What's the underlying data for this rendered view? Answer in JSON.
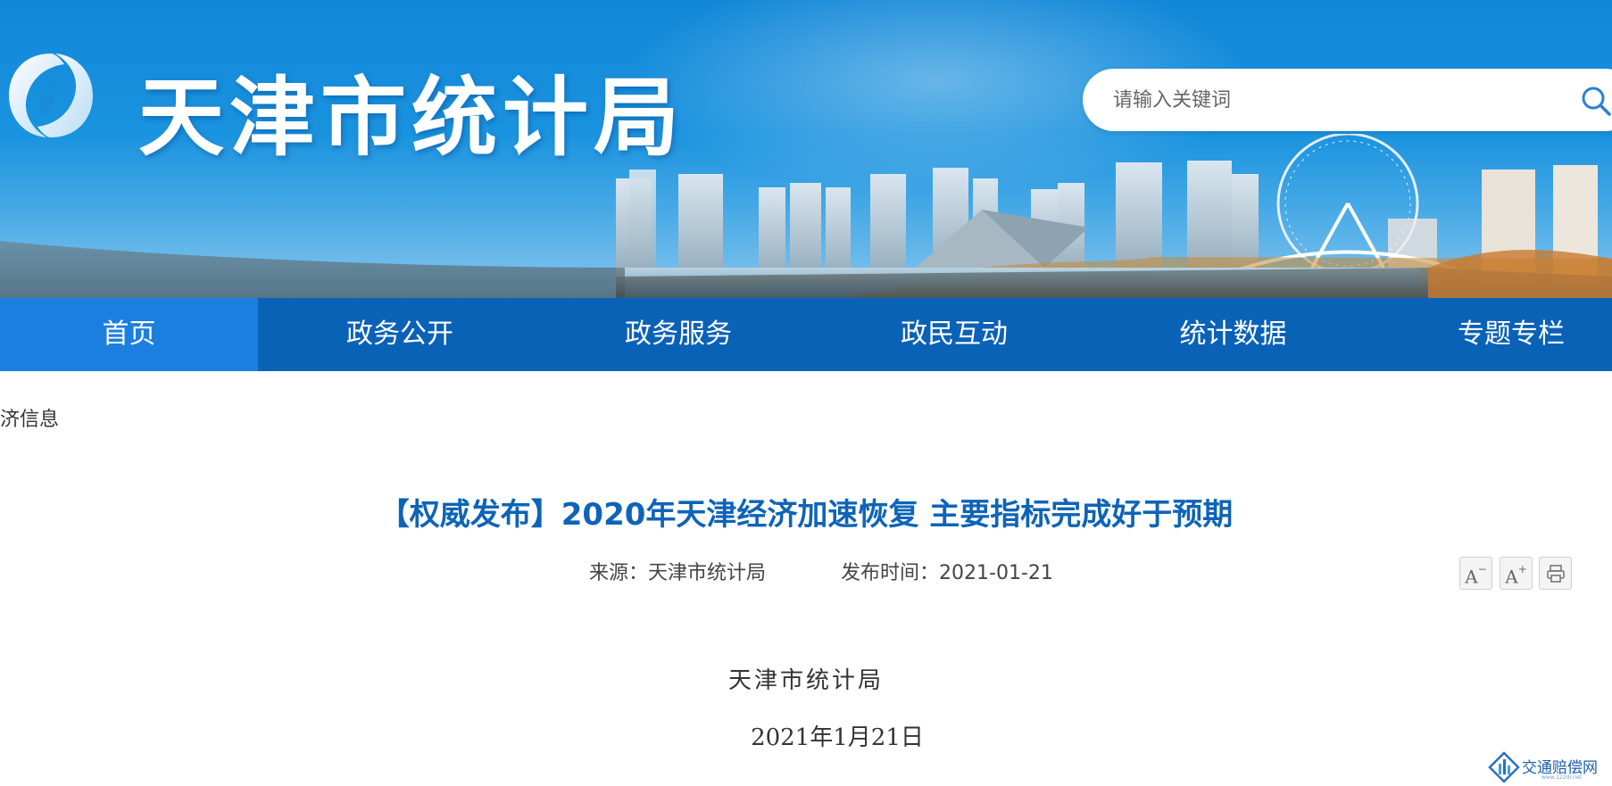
{
  "header": {
    "site_title": "天津市统计局",
    "search": {
      "placeholder": "请输入关键词",
      "value": ""
    }
  },
  "nav": {
    "items": [
      {
        "label": "首页",
        "active": true
      },
      {
        "label": "政务公开",
        "active": false
      },
      {
        "label": "政务服务",
        "active": false
      },
      {
        "label": "政民互动",
        "active": false
      },
      {
        "label": "统计数据",
        "active": false
      },
      {
        "label": "专题专栏",
        "active": false
      }
    ]
  },
  "breadcrumb": {
    "text": "济信息"
  },
  "article": {
    "title": "【权威发布】2020年天津经济加速恢复 主要指标完成好于预期",
    "source_label": "来源：",
    "source_value": "天津市统计局",
    "date_label": "发布时间：",
    "date_value": "2021-01-21",
    "tools": {
      "font_down": "A",
      "font_down_sup": "−",
      "font_up": "A",
      "font_up_sup": "+"
    },
    "body_author": "天津市统计局",
    "body_date": "2021年1月21日"
  },
  "watermark": {
    "text": "交通赔偿网",
    "sub": "www.122dr.net"
  },
  "colors": {
    "nav_bg": "#0a62b7",
    "nav_active_bg": "#1b7fe0",
    "title_blue": "#0d64b8",
    "banner_blue": "#1187d8"
  }
}
